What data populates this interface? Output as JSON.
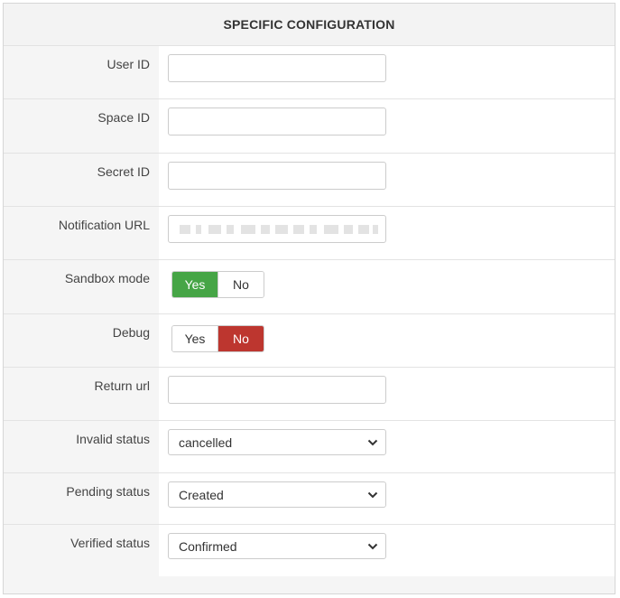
{
  "header": {
    "title": "SPECIFIC CONFIGURATION"
  },
  "fields": {
    "user_id": {
      "label": "User ID",
      "value": ""
    },
    "space_id": {
      "label": "Space ID",
      "value": ""
    },
    "secret_id": {
      "label": "Secret ID",
      "value": ""
    },
    "notification_url": {
      "label": "Notification URL",
      "value_state": "redacted"
    },
    "sandbox_mode": {
      "label": "Sandbox mode",
      "yes": "Yes",
      "no": "No",
      "selected": "Yes"
    },
    "debug": {
      "label": "Debug",
      "yes": "Yes",
      "no": "No",
      "selected": "No"
    },
    "return_url": {
      "label": "Return url",
      "value": ""
    },
    "invalid_status": {
      "label": "Invalid status",
      "selected": "cancelled"
    },
    "pending_status": {
      "label": "Pending status",
      "selected": "Created"
    },
    "verified_status": {
      "label": "Verified status",
      "selected": "Confirmed"
    }
  },
  "icons": {
    "select_arrow": "chevron-down-icon"
  },
  "colors": {
    "yes_active": "#46a546",
    "no_active": "#bd362f"
  }
}
